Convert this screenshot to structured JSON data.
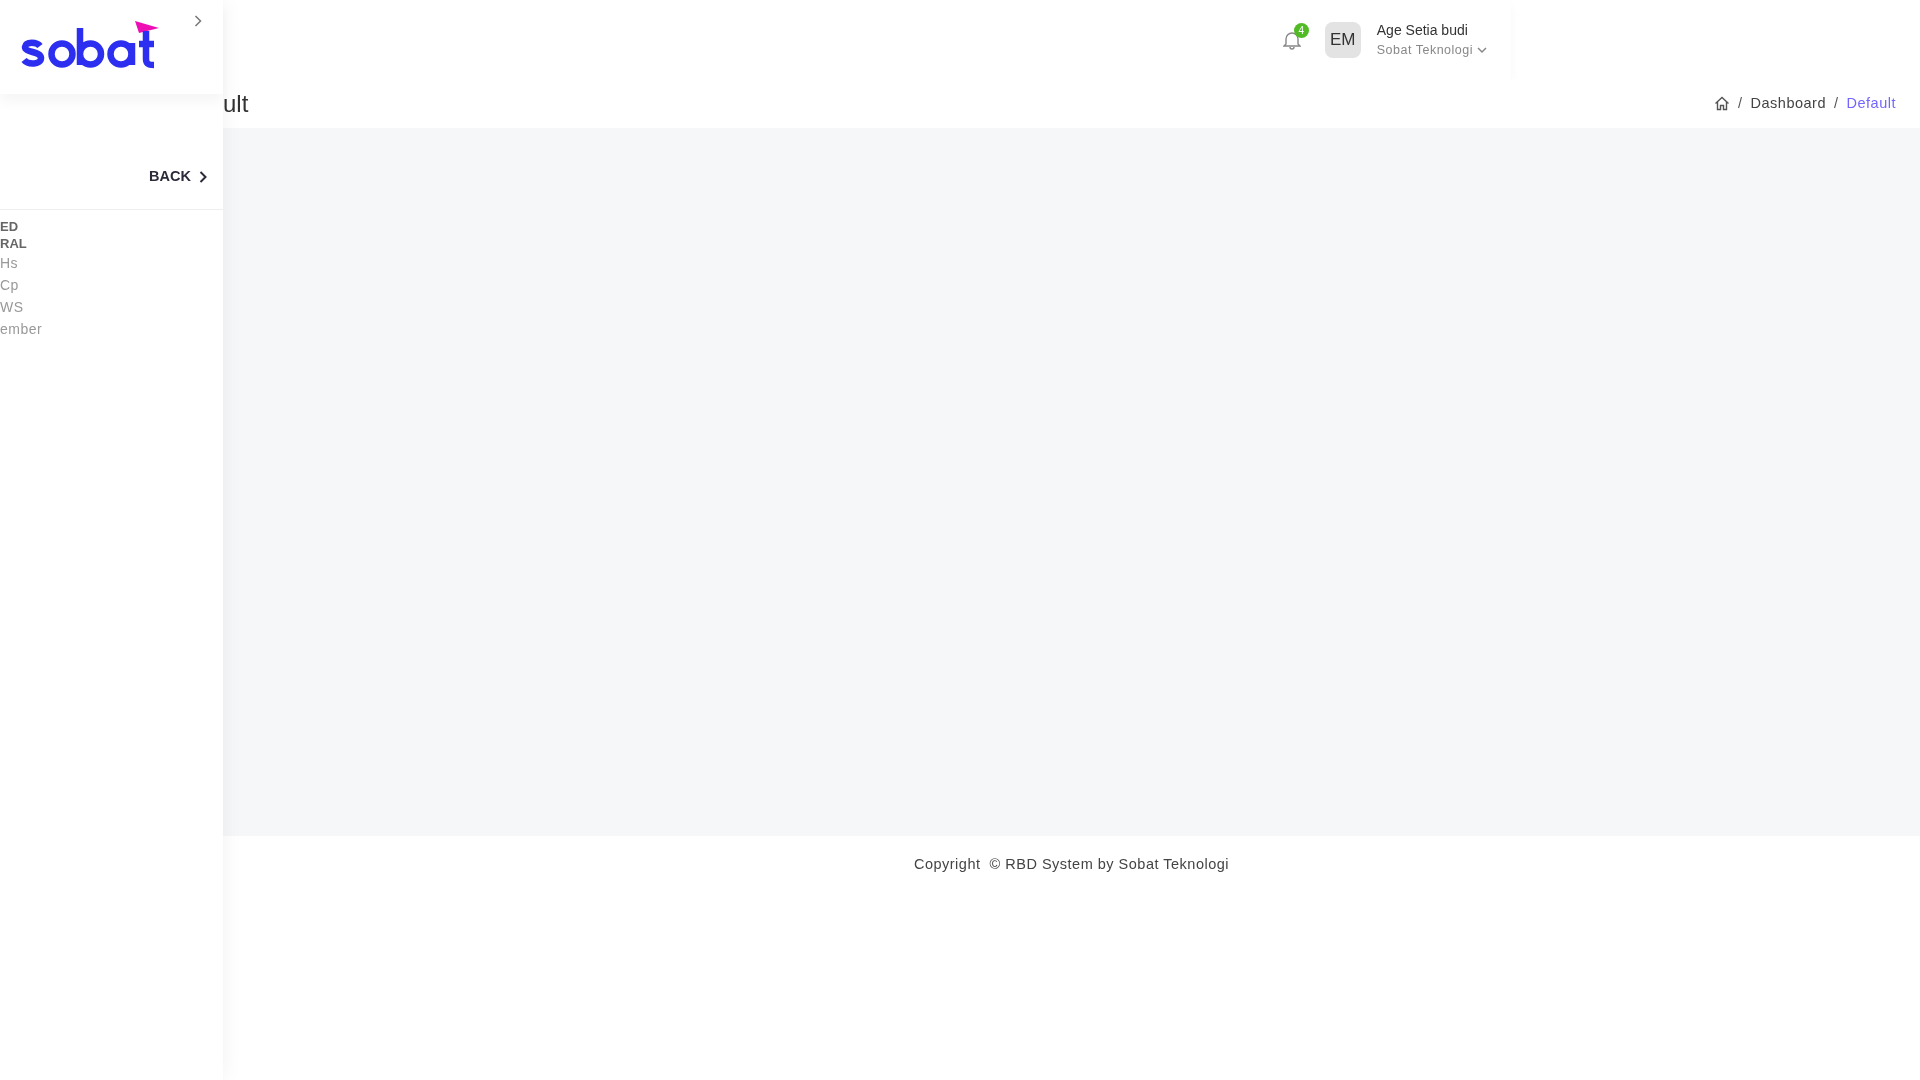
{
  "sidebar": {
    "back_label": "BACK",
    "section_labels": [
      "ED",
      "RAL"
    ],
    "items": [
      {
        "label": "Hs"
      },
      {
        "label": "Cp"
      },
      {
        "label": "WS"
      },
      {
        "label": "ember"
      }
    ]
  },
  "header": {
    "notification_count": "4",
    "user": {
      "initials": "EM",
      "name": "Age Setia budi",
      "company": "Sobat Teknologi"
    }
  },
  "page": {
    "title": "ult",
    "breadcrumb_separator": "/",
    "breadcrumb": [
      "Dashboard",
      "Default"
    ]
  },
  "footer": {
    "text": "Copyright  © RBD System by Sobat Teknologi"
  }
}
